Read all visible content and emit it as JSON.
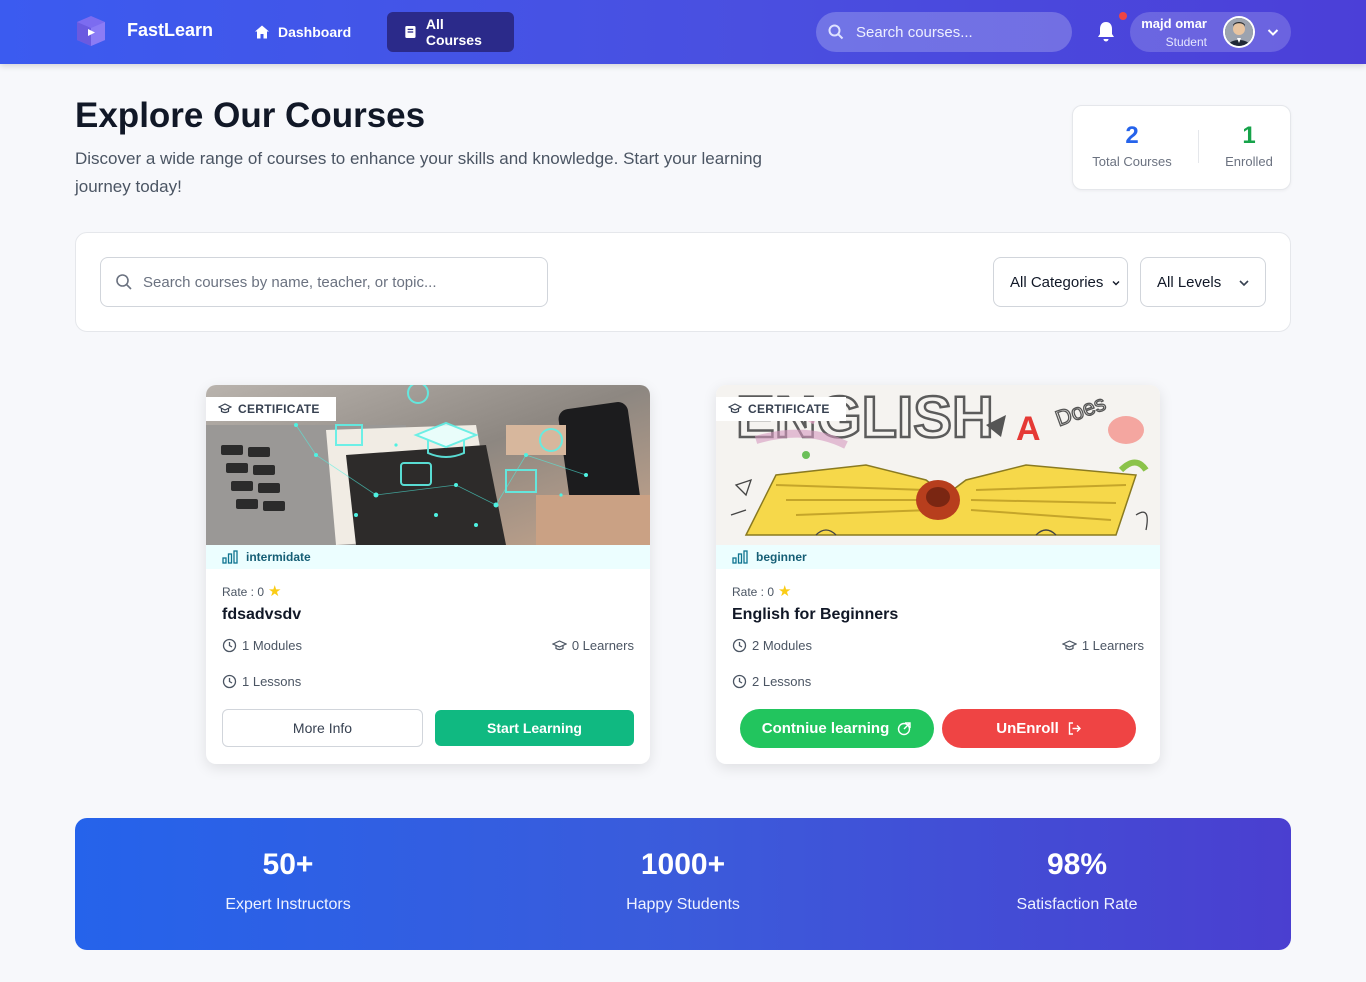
{
  "nav": {
    "brand": "FastLearn",
    "links": [
      {
        "label": "Dashboard",
        "icon": "home-icon",
        "active": false
      },
      {
        "label": "All Courses",
        "icon": "book-icon",
        "active": true
      }
    ],
    "search_placeholder": "Search courses...",
    "notification_icon": "bell-icon",
    "user": {
      "name": "majd omar",
      "role": "Student"
    }
  },
  "hero": {
    "title": "Explore Our Courses",
    "subtitle": "Discover a wide range of courses to enhance your skills and knowledge. Start your learning journey today!",
    "stats": [
      {
        "value": "2",
        "label": "Total Courses"
      },
      {
        "value": "1",
        "label": "Enrolled"
      }
    ]
  },
  "filters": {
    "search_placeholder": "Search courses by name, teacher, or topic...",
    "category": "All Categories",
    "level": "All Levels"
  },
  "courses": [
    {
      "badge": "CERTIFICATE",
      "level": "intermidate",
      "rate_label": "Rate : 0",
      "title": "fdsadvsdv",
      "modules": "1 Modules",
      "learners": "0 Learners",
      "lessons": "1 Lessons",
      "buttons": {
        "more": "More Info",
        "start": "Start Learning"
      }
    },
    {
      "badge": "CERTIFICATE",
      "level": "beginner",
      "rate_label": "Rate : 0",
      "title": "English for Beginners",
      "modules": "2 Modules",
      "learners": "1 Learners",
      "lessons": "2 Lessons",
      "buttons": {
        "continue": "Contniue learning",
        "unenroll": "UnEnroll"
      }
    }
  ],
  "banner": [
    {
      "value": "50+",
      "label": "Expert Instructors"
    },
    {
      "value": "1000+",
      "label": "Happy Students"
    },
    {
      "value": "98%",
      "label": "Satisfaction Rate"
    }
  ],
  "colors": {
    "primary": "#3b5bf0",
    "active_nav": "#2b2a8a",
    "success": "#10b981",
    "continue": "#22c55e",
    "danger": "#ef4444",
    "total_stat": "#2563eb",
    "enrolled_stat": "#16a34a"
  }
}
